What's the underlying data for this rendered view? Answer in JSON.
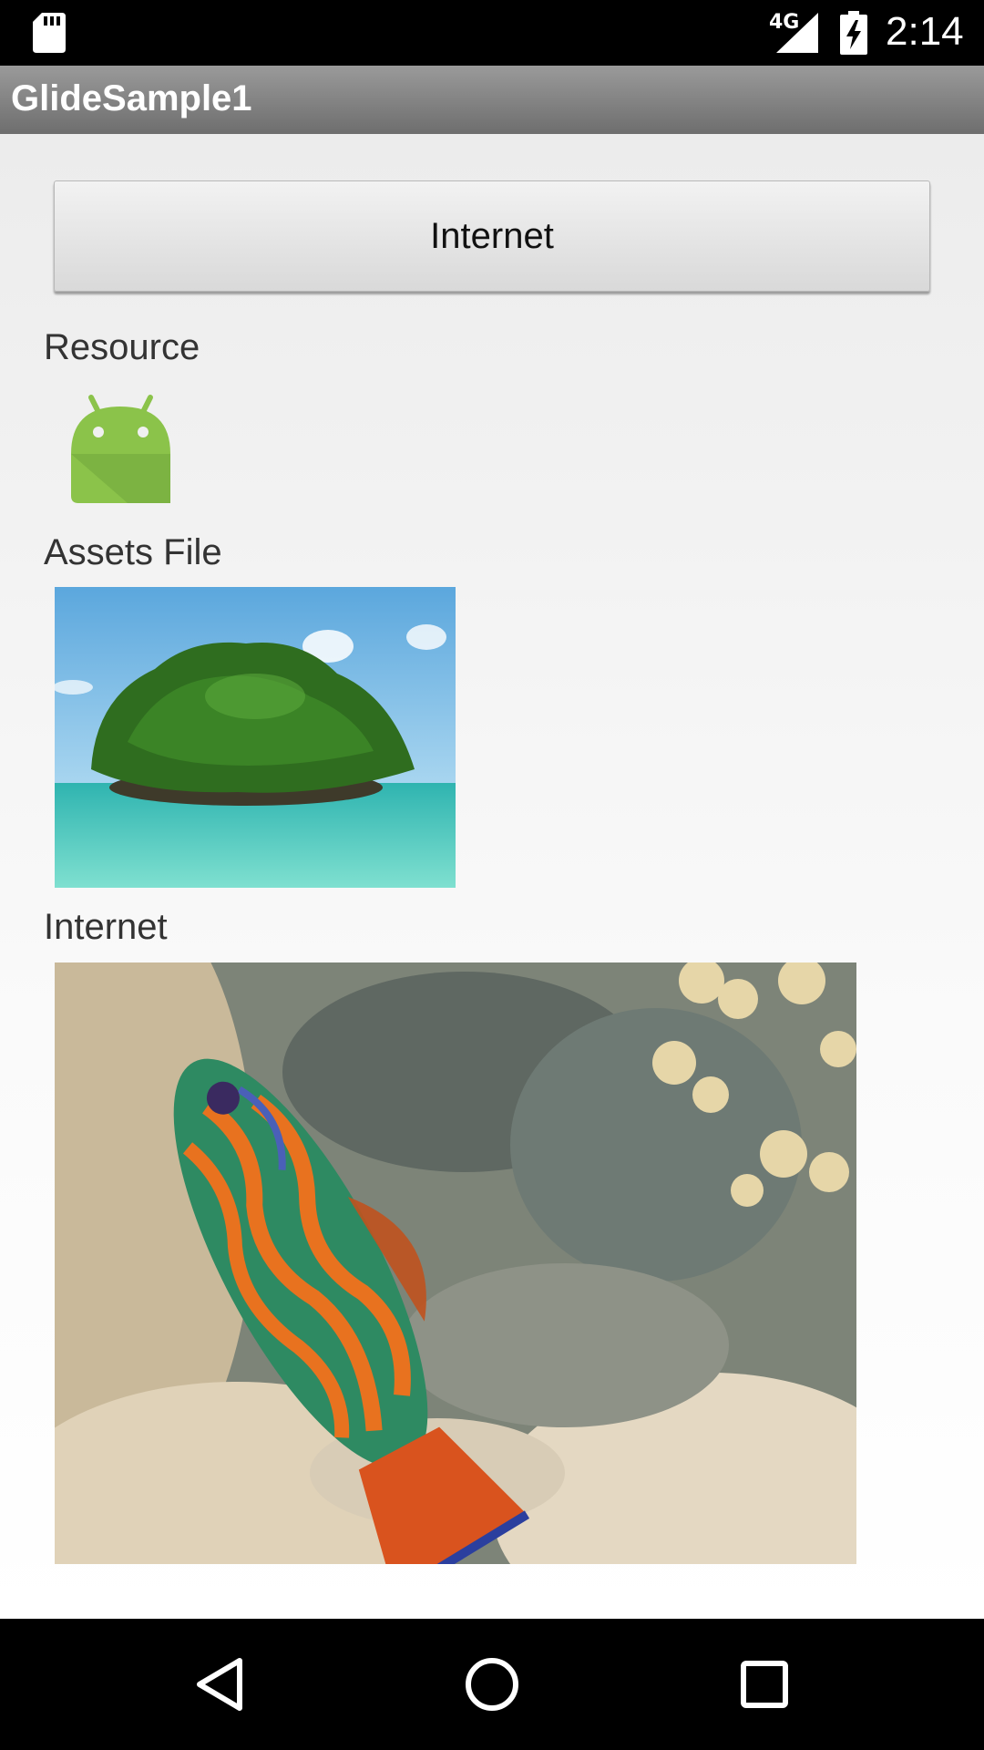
{
  "status_bar": {
    "network_type": "4G",
    "time": "2:14",
    "icons": [
      "sd-card-icon",
      "signal-icon",
      "battery-charging-icon"
    ]
  },
  "action_bar": {
    "title": "GlideSample1"
  },
  "main": {
    "internet_button_label": "Internet",
    "sections": {
      "resource_label": "Resource",
      "assets_label": "Assets File",
      "internet_label": "Internet"
    },
    "resource_icon": "android-robot-icon"
  },
  "nav_bar": {
    "icons": [
      "back-icon",
      "home-icon",
      "recents-icon"
    ]
  },
  "colors": {
    "action_bar": "#8a8a8a",
    "android_green": "#8bc34a",
    "background": "#f0f0f0"
  }
}
